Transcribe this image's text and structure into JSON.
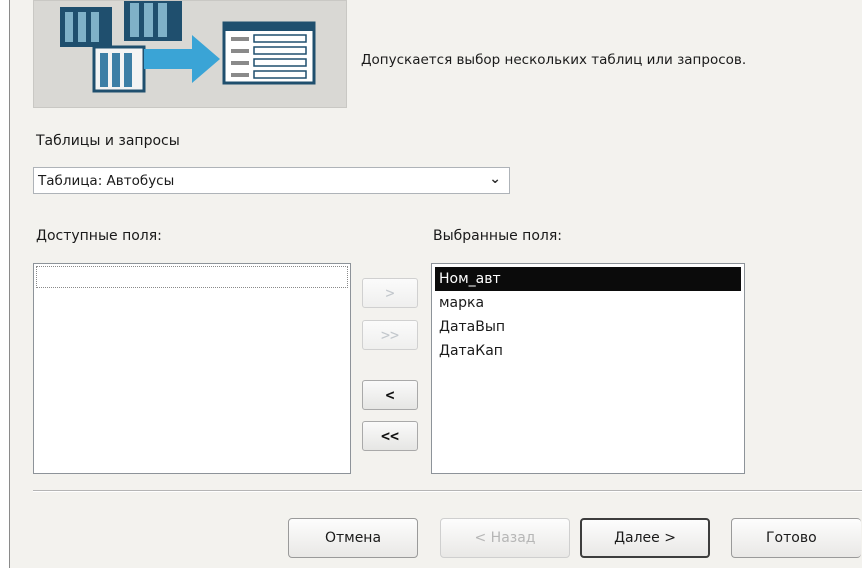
{
  "description": "Допускается выбор нескольких таблиц или запросов.",
  "tables_label": "Таблицы и запросы",
  "table_select": {
    "value": "Таблица: Автобусы"
  },
  "available_label": "Доступные поля:",
  "selected_label": "Выбранные поля:",
  "selected_fields": [
    "Ном_авт",
    "марка",
    "ДатаВып",
    "ДатаКап"
  ],
  "move_buttons": {
    "add": ">",
    "add_all": ">>",
    "remove": "<",
    "remove_all": "<<"
  },
  "buttons": {
    "cancel": "Отмена",
    "back": "< Назад",
    "next": "Далее >",
    "finish": "Готово"
  },
  "icons": {
    "dropdown": "chevron-down-icon",
    "wizard": "table-transfer-illustration"
  }
}
